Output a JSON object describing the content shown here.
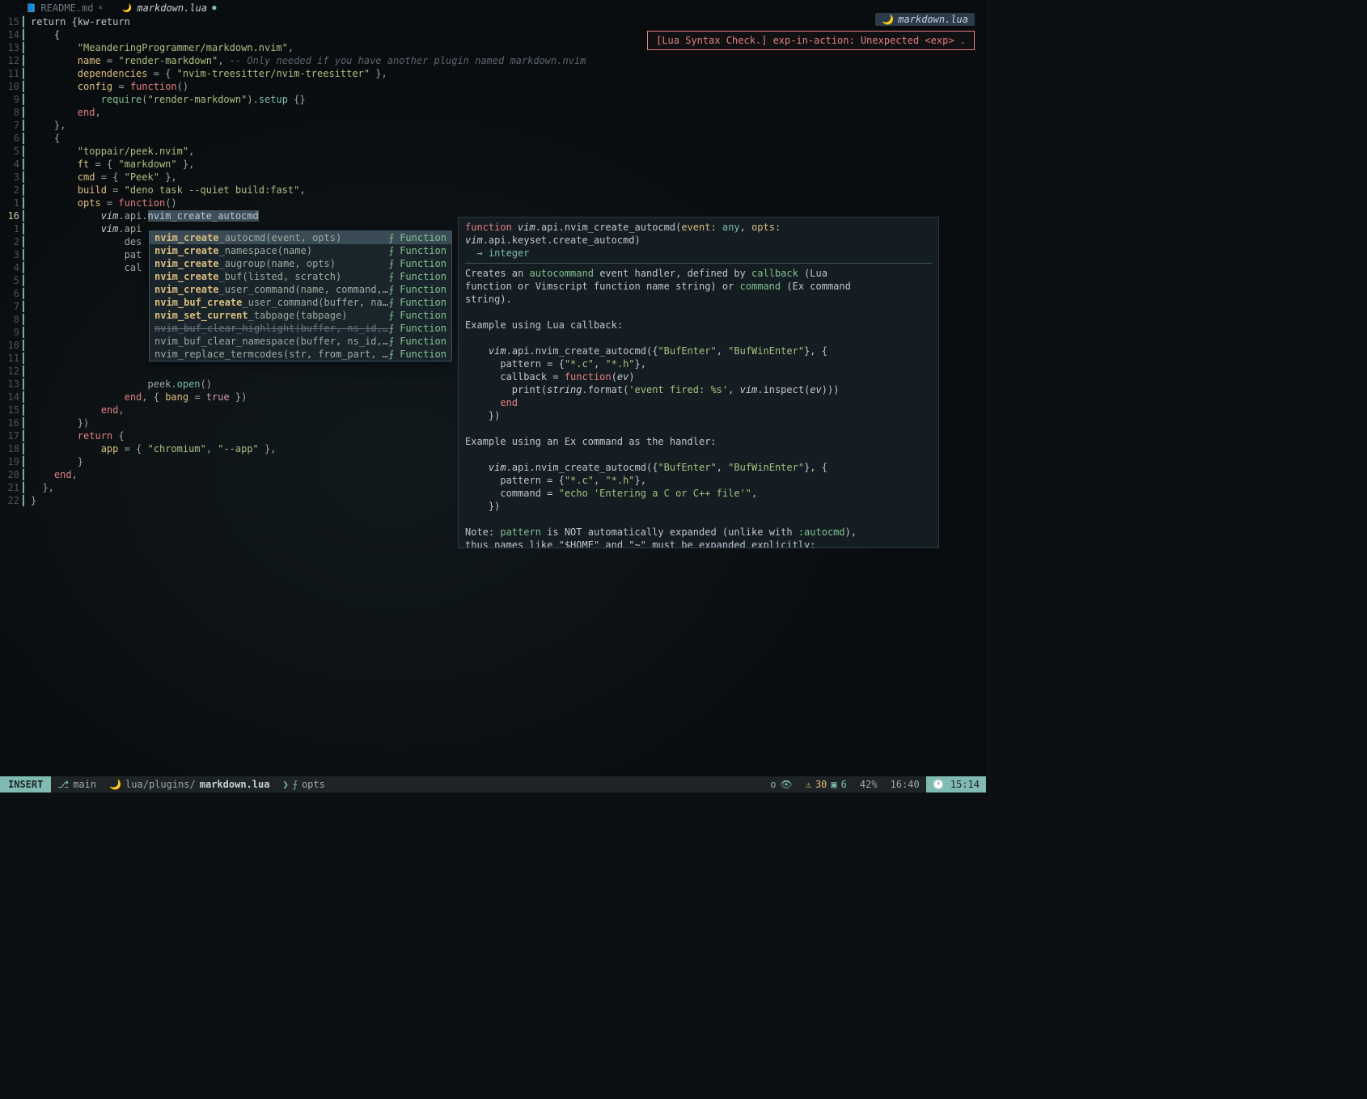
{
  "tabs": [
    {
      "icon": "📘",
      "name": "README.md",
      "modified": false
    },
    {
      "icon": "🌙",
      "name": "markdown.lua",
      "modified": true
    }
  ],
  "filename_badge": {
    "icon": "🌙",
    "text": "markdown.lua"
  },
  "diagnostic": "[Lua Syntax Check.] exp-in-action: Unexpected <exp> .",
  "gutter_lines": [
    "15",
    "14",
    "13",
    "12",
    "11",
    "10",
    "9",
    "8",
    "7",
    "6",
    "5",
    "4",
    "3",
    "2",
    "1",
    "16",
    "1",
    "2",
    "3",
    "4",
    "5",
    "6",
    "7",
    "8",
    "9",
    "10",
    "11",
    "12",
    "13",
    "14",
    "15",
    "16",
    "17",
    "18",
    "19",
    "20",
    "21",
    "22"
  ],
  "code_lines": {
    "l0": "return {",
    "l1": "    {",
    "l2_a": "        \"MeanderingProgrammer/markdown.nvim\"",
    "l2_b": ",",
    "l3_a": "        name = ",
    "l3_b": "\"render-markdown\"",
    "l3_c": ", ",
    "l3_d": "-- Only needed if you have another plugin named markdown.nvim",
    "l4_a": "        dependencies = { ",
    "l4_b": "\"nvim-treesitter/nvim-treesitter\"",
    "l4_c": " },",
    "l5_a": "        config = ",
    "l5_b": "function",
    "l5_c": "()",
    "l6_a": "            require(",
    "l6_b": "\"render-markdown\"",
    "l6_c": ").setup {}",
    "l7": "        end,",
    "l8": "    },",
    "l9": "    {",
    "l10": "        \"toppair/peek.nvim\",",
    "l11_a": "        ft = { ",
    "l11_b": "\"markdown\"",
    "l11_c": " },",
    "l12_a": "        cmd = { ",
    "l12_b": "\"Peek\"",
    "l12_c": " },",
    "l13_a": "        build = ",
    "l13_b": "\"deno task --quiet build:fast\"",
    "l13_c": ",",
    "l14_a": "        opts = ",
    "l14_b": "function",
    "l14_c": "()",
    "l15_a": "            ",
    "l15_b": "vim",
    "l15_c": ".api.",
    "l15_d": "nvim_create_autocmd",
    "l16_a": "            ",
    "l16_b": "vim",
    "l16_c": ".api",
    "l17": "                des",
    "l18": "                pat",
    "l19": "                cal",
    "l20": "",
    "l21": "",
    "l22": "",
    "l23": "",
    "l24": "",
    "l25": "",
    "l26": "",
    "l27": "",
    "l28": "                    peek.open()",
    "l29_a": "                end, { bang = ",
    "l29_b": "true",
    "l29_c": " })",
    "l30": "            end,",
    "l31": "        })",
    "l32_a": "        return {",
    "l33_a": "            app = { ",
    "l33_b": "\"chromium\"",
    "l33_c": ", ",
    "l33_d": "\"--app\"",
    "l33_e": " },",
    "l34": "        }",
    "l35": "    end,",
    "l36": "  },",
    "l37": "}"
  },
  "completions": [
    {
      "label_pre": "nvim_create",
      "label_suf": "_autocmd(event, opts)",
      "kind": "Function",
      "selected": true
    },
    {
      "label_pre": "nvim_create",
      "label_suf": "_namespace(name)",
      "kind": "Function"
    },
    {
      "label_pre": "nvim_create",
      "label_suf": "_augroup(name, opts)",
      "kind": "Function"
    },
    {
      "label_pre": "nvim_create",
      "label_suf": "_buf(listed, scratch)",
      "kind": "Function"
    },
    {
      "label_pre": "nvim_create",
      "label_suf": "_user_command(name, command,…",
      "kind": "Function"
    },
    {
      "label_pre": "nvim_buf_create",
      "label_suf": "_user_command(buffer, na…",
      "kind": "Function"
    },
    {
      "label_pre": "nvim_set_current",
      "label_suf": "_tabpage(tabpage)",
      "kind": "Function"
    },
    {
      "label_pre": "nvim_buf_clear_highlight(buffer, ns_id,…",
      "label_suf": "",
      "kind": "Function",
      "strike": true
    },
    {
      "label_pre": "nvim_buf_clear_namespace(buffer, ns_id, …",
      "label_suf": "",
      "kind": "Function"
    },
    {
      "label_pre": "nvim_replace_termcodes(str, from_part, …",
      "label_suf": "",
      "kind": "Function"
    }
  ],
  "doc": {
    "sig_prefix": "function ",
    "sig_mod": "vim",
    "sig_path": ".api.nvim_create_autocmd(",
    "sig_p1": "event",
    "sig_c1": ": ",
    "sig_t1": "any",
    "sig_c2": ", ",
    "sig_p2": "opts",
    "sig_c3": ": ",
    "sig_mod2": "vim",
    "sig_path2": ".api.keyset.create_autocmd)",
    "sig_ret": "  → integer",
    "body": [
      "Creates an |autocommand| event handler, defined by |callback| (Lua",
      "function or Vimscript function name string) or |command| (Ex command",
      "string).",
      "",
      "Example using Lua callback:",
      "",
      "    |vim|.api.nvim_create_autocmd({|\"BufEnter\"|, |\"BufWinEnter\"|}, {",
      "      pattern = {|\"*.c\"|, |\"*.h\"|},",
      "      callback = |function|(|ev|)",
      "        print(|string|.format(|'event fired: %s'|, |vim|.inspect(|ev|)))",
      "      |end|",
      "    })",
      "",
      "Example using an Ex command as the handler:",
      "",
      "    |vim|.api.nvim_create_autocmd({|\"BufEnter\"|, |\"BufWinEnter\"|}, {",
      "      pattern = {|\"*.c\"|, |\"*.h\"|},",
      "      command = |\"echo 'Entering a C or C++ file'\"|,",
      "    })",
      "",
      "Note: |pattern| is NOT automatically expanded (unlike with |:autocmd|),",
      "thus names like \"$HOME\" and \"~\" must be expanded explicitly:"
    ]
  },
  "statusline": {
    "mode": "INSERT",
    "branch": "main",
    "path": "lua/plugins/",
    "file": "markdown.lua",
    "context": "opts",
    "rec": "o",
    "warn_count": "30",
    "hint_count": "6",
    "percent": "42%",
    "position": "16:40",
    "time": "15:14"
  }
}
